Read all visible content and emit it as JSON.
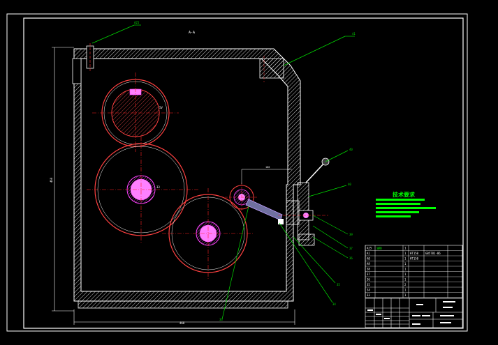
{
  "drawing": {
    "section_label": "A-A",
    "width_dimension": "468",
    "height_dimension": "460",
    "gear_label_top": "5V",
    "gear_label_mid": "33",
    "offset_dimension": "100"
  },
  "callouts": [
    "A25",
    "41",
    "40",
    "40",
    "39",
    "37",
    "36",
    "35",
    "34",
    "33"
  ],
  "technical_requirements": {
    "title": "技术要求",
    "lines": [
      "",
      "",
      "",
      "",
      ""
    ]
  },
  "parts_list": {
    "rows": [
      {
        "no": "A25",
        "name": "油标",
        "qty": "1",
        "material": "",
        "note": ""
      },
      {
        "no": "A1",
        "name": "",
        "qty": "1",
        "material": "HT150",
        "note": "GB5781-86"
      },
      {
        "no": "A0",
        "name": "",
        "qty": "1",
        "material": "HT150",
        "note": ""
      },
      {
        "no": "A9",
        "name": "",
        "qty": "1",
        "material": "",
        "note": ""
      },
      {
        "no": "38",
        "name": "",
        "qty": "1",
        "material": "",
        "note": ""
      },
      {
        "no": "37",
        "name": "",
        "qty": "1",
        "material": "",
        "note": ""
      },
      {
        "no": "36",
        "name": "",
        "qty": "1",
        "material": "",
        "note": ""
      },
      {
        "no": "35",
        "name": "",
        "qty": "2",
        "material": "",
        "note": ""
      },
      {
        "no": "34",
        "name": "",
        "qty": "1",
        "material": "",
        "note": ""
      },
      {
        "no": "33",
        "name": "",
        "qty": "1",
        "material": "",
        "note": ""
      }
    ]
  },
  "colors": {
    "frame": "#ffffff",
    "title_text": "#00ff00",
    "centerline": "#ff2020",
    "gear": "#ff4040",
    "hub": "#ff40ff",
    "leader": "#00cc00",
    "handle": "#c0a0ff"
  }
}
